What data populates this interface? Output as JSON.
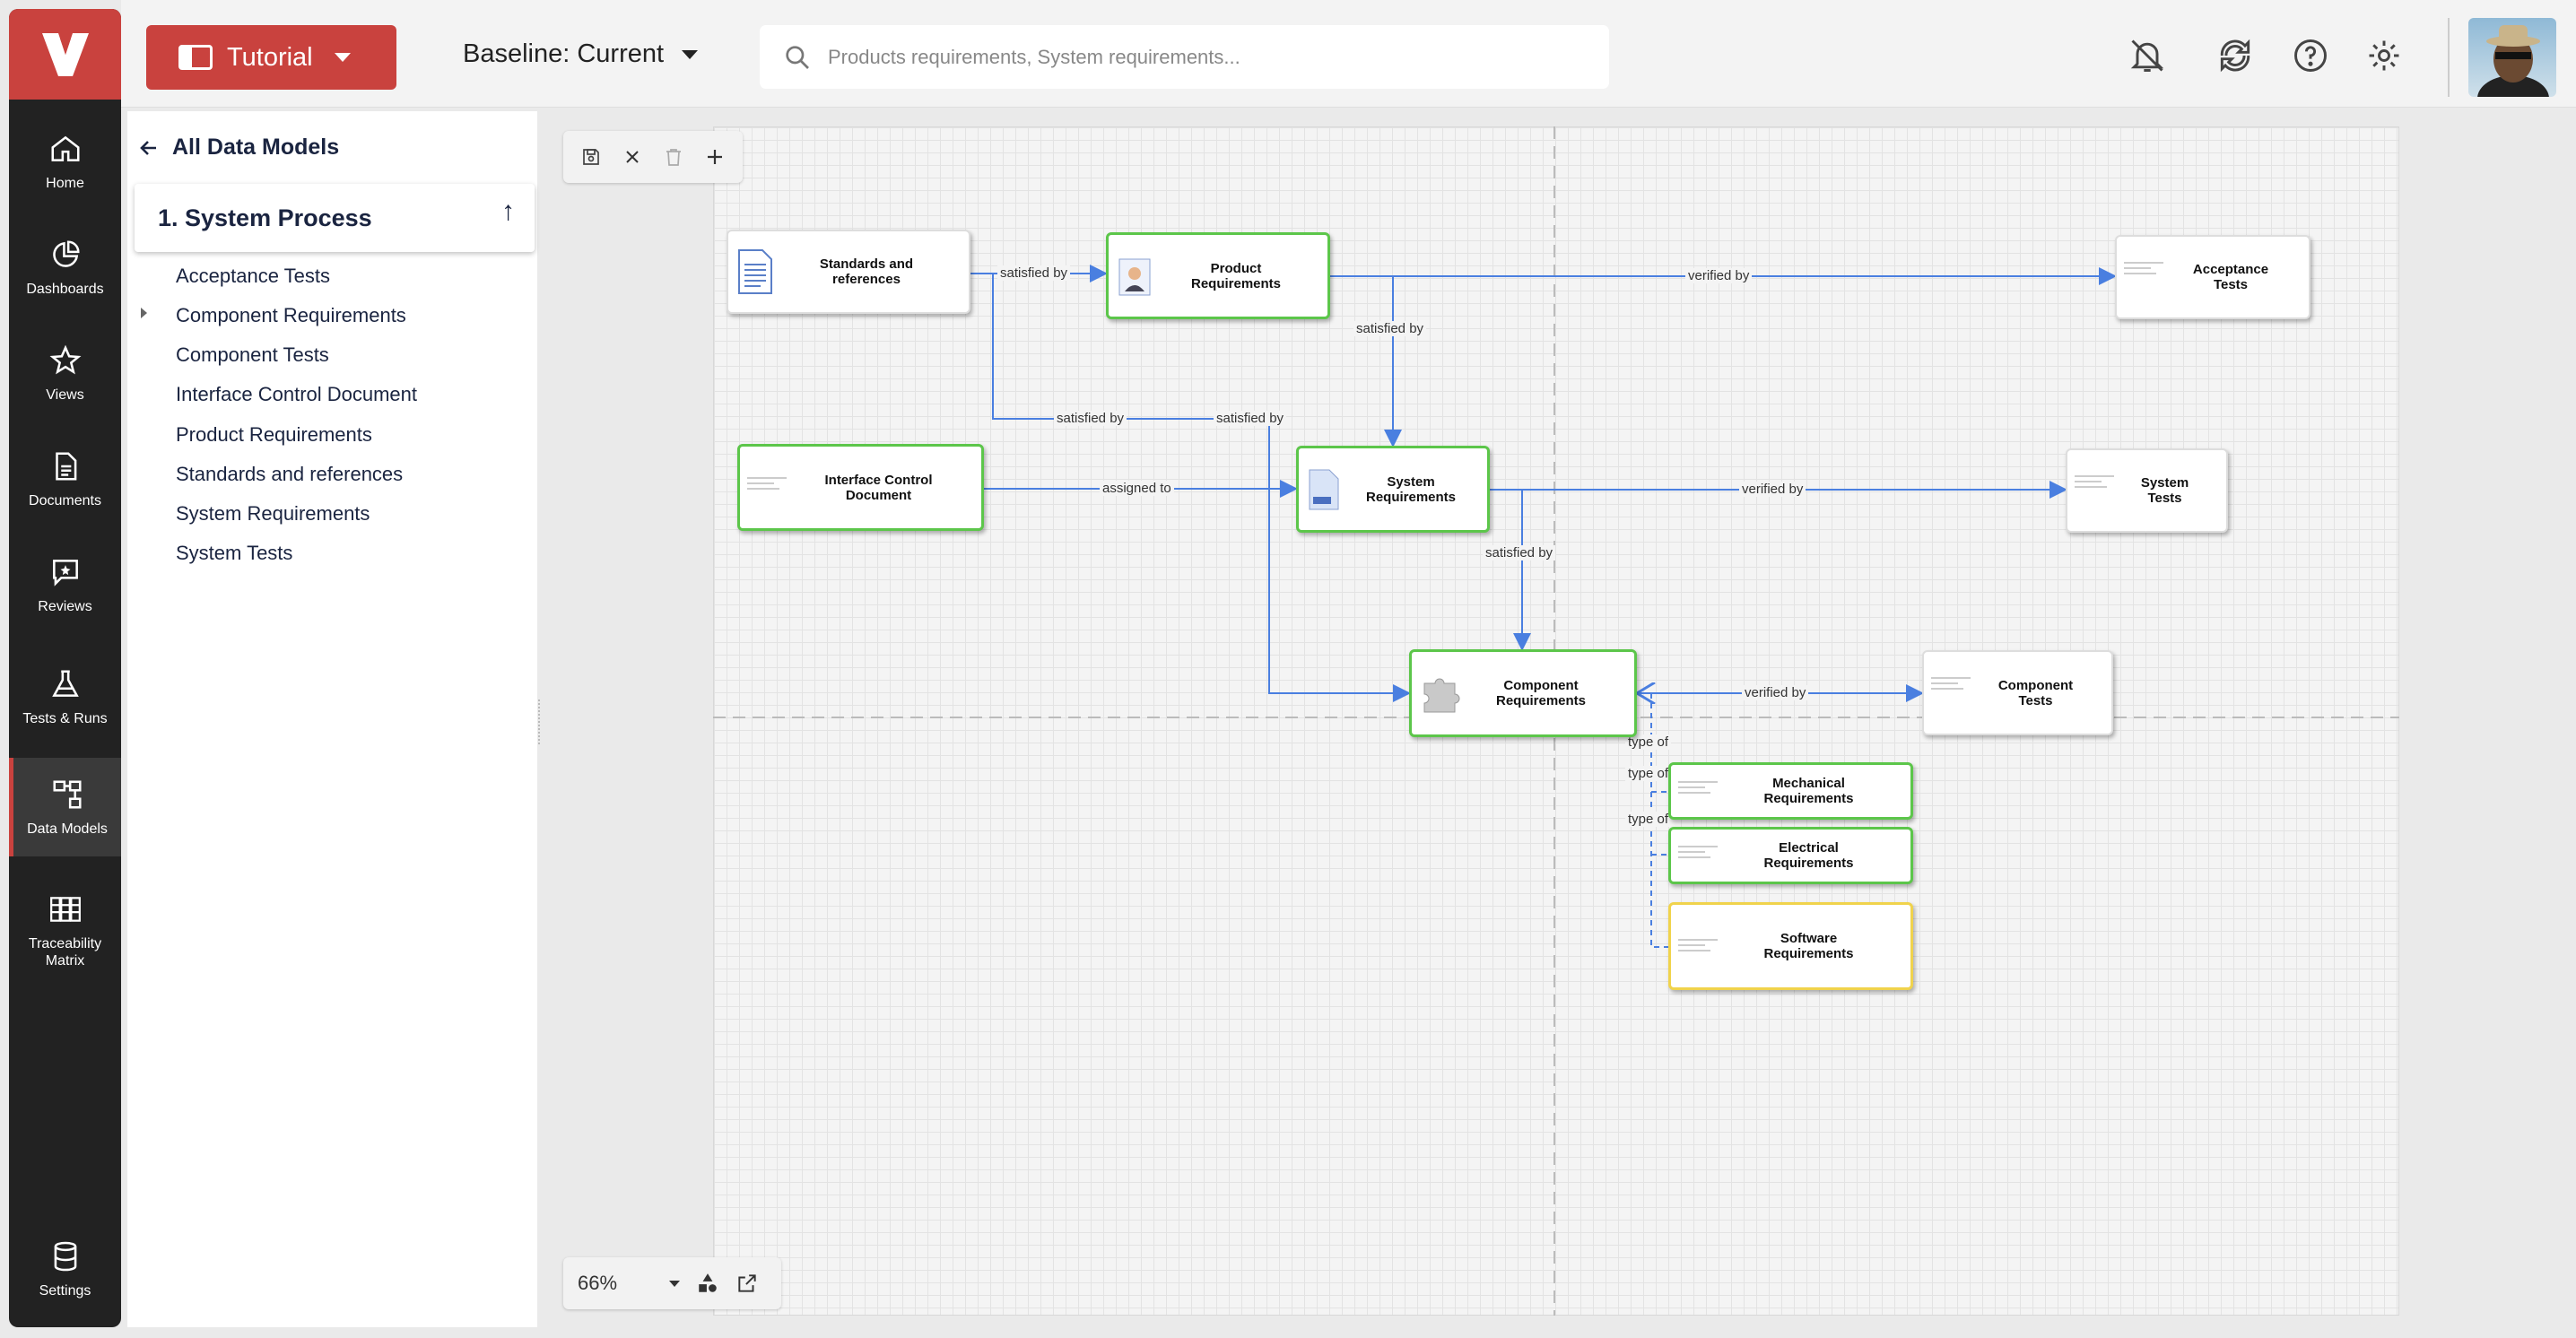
{
  "app": {
    "brand_color": "#c9423e",
    "logo_letter": "V"
  },
  "nav": [
    {
      "label": "Home",
      "icon": "home-icon"
    },
    {
      "label": "Dashboards",
      "icon": "pie-chart-icon"
    },
    {
      "label": "Views",
      "icon": "star-icon"
    },
    {
      "label": "Documents",
      "icon": "document-icon"
    },
    {
      "label": "Reviews",
      "icon": "review-icon"
    },
    {
      "label": "Tests & Runs",
      "icon": "flask-icon"
    },
    {
      "label": "Data Models",
      "icon": "data-model-icon",
      "active": true
    },
    {
      "label": "Traceability Matrix",
      "icon": "matrix-icon"
    },
    {
      "label": "Settings",
      "icon": "database-icon"
    }
  ],
  "header": {
    "project": "Tutorial",
    "baseline": "Baseline: Current",
    "search_placeholder": "Products requirements, System requirements..."
  },
  "sidebar": {
    "back_label": "All Data Models",
    "process_title": "1. System Process",
    "items": [
      "Acceptance Tests",
      "Component Requirements",
      "Component Tests",
      "Interface Control Document",
      "Product Requirements",
      "Standards and references",
      "System Requirements",
      "System Tests"
    ]
  },
  "diagram": {
    "nodes": {
      "standards": "Standards and references",
      "product": "Product Requirements",
      "acceptance": "Acceptance Tests",
      "icd": "Interface Control Document",
      "system_req": "System Requirements",
      "system_tests": "System Tests",
      "component_req": "Component Requirements",
      "component_tests": "Component Tests",
      "mechanical": "Mechanical Requirements",
      "electrical": "Electrical Requirements",
      "software": "Software Requirements"
    },
    "edges": {
      "satisfied_by": "satisfied by",
      "verified_by": "verified by",
      "assigned_to": "assigned to",
      "type_of": "type of"
    }
  },
  "zoom": {
    "level": "66%"
  },
  "colors": {
    "link": "#4a7fe0",
    "node_green": "#5cc64a",
    "node_yellow": "#f0d34c"
  }
}
